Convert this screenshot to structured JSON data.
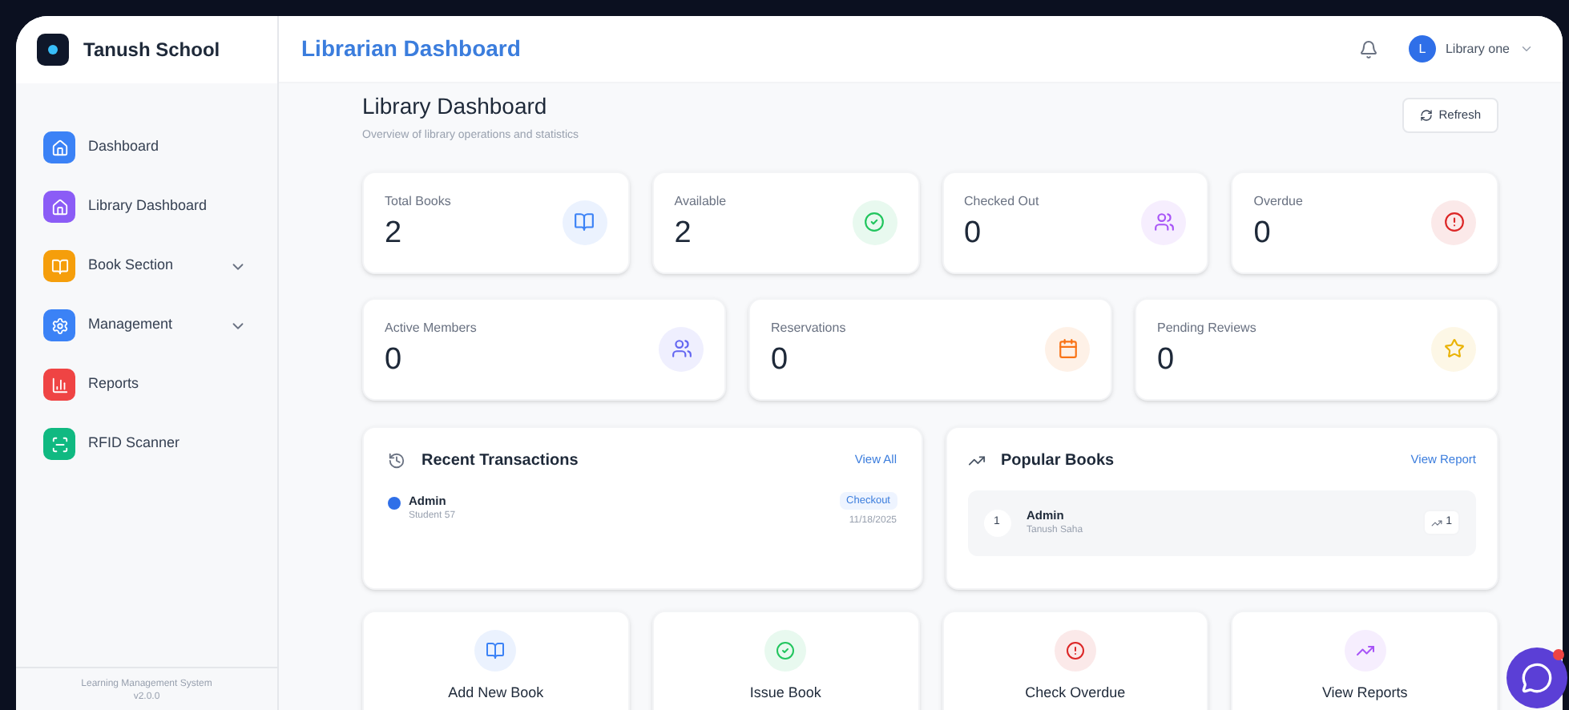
{
  "sidebar": {
    "brand": "Tanush School",
    "items": [
      {
        "label": "Dashboard",
        "color": "#3b82f6",
        "expandable": false
      },
      {
        "label": "Library Dashboard",
        "color": "#8b5cf6",
        "expandable": false
      },
      {
        "label": "Book Section",
        "color": "#f59e0b",
        "expandable": true
      },
      {
        "label": "Management",
        "color": "#3b82f6",
        "expandable": true
      },
      {
        "label": "Reports",
        "color": "#ef4444",
        "expandable": false
      },
      {
        "label": "RFID Scanner",
        "color": "#10b981",
        "expandable": false
      }
    ],
    "footer": [
      "Learning Management System",
      "v2.0.0"
    ]
  },
  "header": {
    "title": "Librarian Dashboard",
    "user": {
      "initial": "L",
      "name": "Library one"
    }
  },
  "page": {
    "title": "Library Dashboard",
    "subtitle": "Overview of library operations and statistics",
    "refresh": "Refresh"
  },
  "stats": [
    {
      "label": "Total Books",
      "value": "2",
      "color": "#3b82f6"
    },
    {
      "label": "Available",
      "value": "2",
      "color": "#22c55e"
    },
    {
      "label": "Checked Out",
      "value": "0",
      "color": "#a855f7"
    },
    {
      "label": "Overdue",
      "value": "0",
      "color": "#dc2626"
    }
  ],
  "stats_2": [
    {
      "label": "Active Members",
      "value": "0",
      "color": "#6366f1"
    },
    {
      "label": "Reservations",
      "value": "0",
      "color": "#f97316"
    },
    {
      "label": "Pending Reviews",
      "value": "0",
      "color": "#eab308"
    }
  ],
  "recent_transactions": {
    "title": "Recent Transactions",
    "link": "View All",
    "items": [
      {
        "name": "Admin",
        "detail": "Student 57",
        "type": "Checkout",
        "date": "11/18/2025"
      }
    ]
  },
  "popular_books": {
    "title": "Popular Books",
    "link": "View Report",
    "items": [
      {
        "rank": "1",
        "title": "Admin",
        "author": "Tanush Saha",
        "count": "1"
      }
    ]
  },
  "actions": [
    {
      "label": "Add New Book",
      "color": "#3b82f6"
    },
    {
      "label": "Issue Book",
      "color": "#22c55e"
    },
    {
      "label": "Check Overdue",
      "color": "#dc2626"
    },
    {
      "label": "View Reports",
      "color": "#a855f7"
    }
  ]
}
